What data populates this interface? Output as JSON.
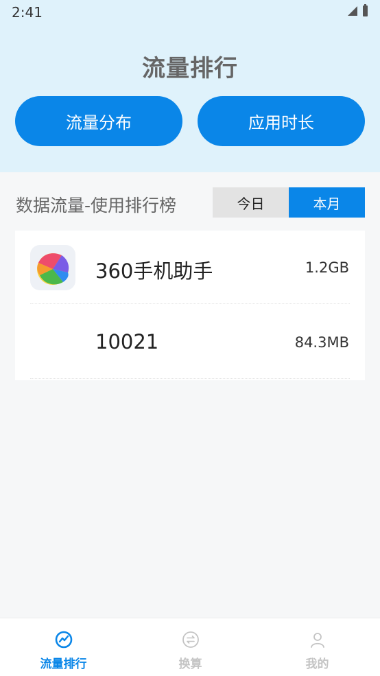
{
  "status_bar": {
    "time": "2:41"
  },
  "header": {
    "title": "流量排行",
    "buttons": {
      "left": "流量分布",
      "right": "应用时长"
    }
  },
  "ranking": {
    "section_title": "数据流量-使用排行榜",
    "segments": {
      "today": "今日",
      "month": "本月"
    },
    "selected_segment": "month",
    "items": [
      {
        "name": "360手机助手",
        "usage": "1.2GB",
        "icon": "360-assistant-icon"
      },
      {
        "name": "10021",
        "usage": "84.3MB",
        "icon": ""
      }
    ]
  },
  "tabbar": {
    "tabs": [
      {
        "label": "流量排行",
        "icon": "traffic-chart-icon",
        "active": true
      },
      {
        "label": "换算",
        "icon": "convert-icon",
        "active": false
      },
      {
        "label": "我的",
        "icon": "profile-icon",
        "active": false
      }
    ]
  },
  "colors": {
    "accent": "#0a86e8",
    "header_bg": "#dff2fb",
    "page_bg": "#f6f7f8"
  }
}
